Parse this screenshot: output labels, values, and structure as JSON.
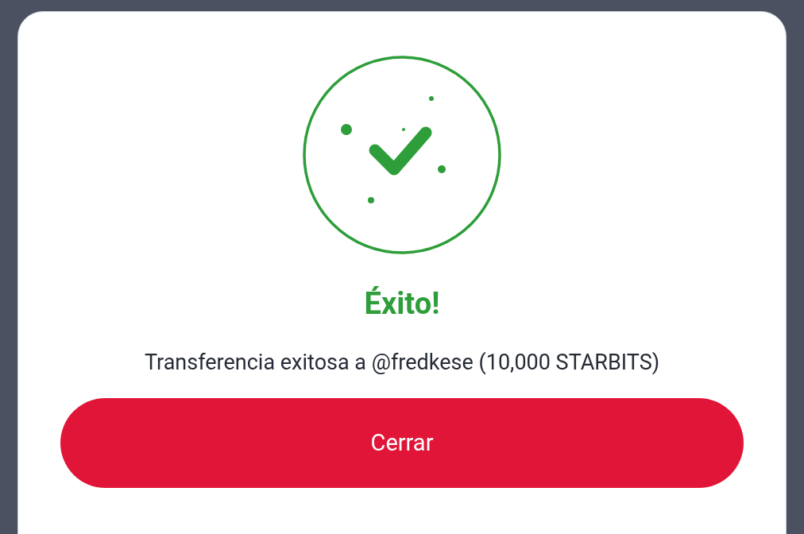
{
  "dialog": {
    "title": "Éxito!",
    "message": "Transferencia exitosa a @fredkese (10,000 STARBITS)",
    "button": "Cerrar"
  }
}
